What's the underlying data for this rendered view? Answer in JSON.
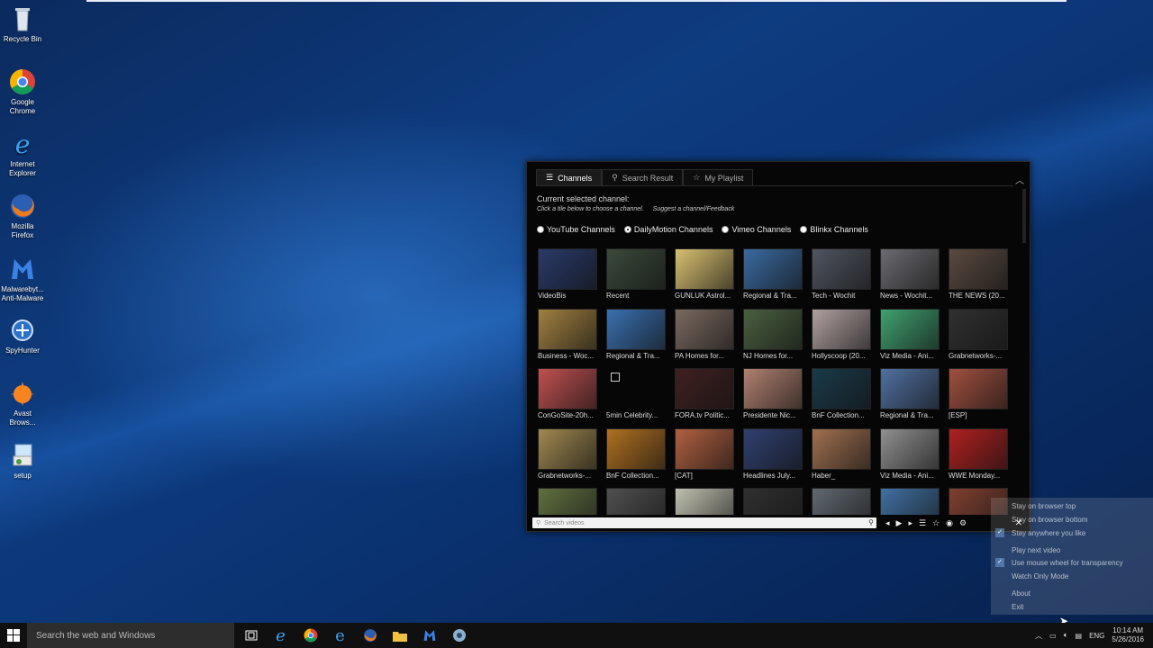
{
  "desktop": {
    "icons": [
      {
        "label": "Recycle Bin"
      },
      {
        "label": "Google Chrome"
      },
      {
        "label": "Internet Explorer"
      },
      {
        "label": "Mozilla Firefox"
      },
      {
        "label": "Malwarebyt... Anti-Malware"
      },
      {
        "label": "SpyHunter"
      },
      {
        "label": "Avast Brows..."
      },
      {
        "label": "setup"
      }
    ]
  },
  "app": {
    "tabs": [
      {
        "label": "Channels",
        "icon": "list-icon"
      },
      {
        "label": "Search Result",
        "icon": "search-icon"
      },
      {
        "label": "My Playlist",
        "icon": "star-icon"
      }
    ],
    "collapse_icon": "chevron-up-icon",
    "current_channel_label": "Current selected channel:",
    "hint": "Click a tile below to choose a channel.",
    "suggest_link": "Suggest a channel/Feedback",
    "radios": [
      {
        "label": "YouTube Channels",
        "selected": false
      },
      {
        "label": "DailyMotion Channels",
        "selected": true
      },
      {
        "label": "Vimeo Channels",
        "selected": false
      },
      {
        "label": "Blinkx Channels",
        "selected": false
      }
    ],
    "tiles": [
      {
        "label": "VideoBis",
        "color": "#2a3a6a"
      },
      {
        "label": "Recent",
        "color": "#3a4a3a"
      },
      {
        "label": "GUNLUK Astrol...",
        "color": "#d8c070"
      },
      {
        "label": "Regional & Tra...",
        "color": "#3a6aa0"
      },
      {
        "label": "Tech - Wochit",
        "color": "#505560"
      },
      {
        "label": "News - Wochit...",
        "color": "#6a6a70"
      },
      {
        "label": "THE NEWS (20...",
        "color": "#5a4a40"
      },
      {
        "label": "Business - Woc...",
        "color": "#a08040"
      },
      {
        "label": "Regional & Tra...",
        "color": "#3a70b0"
      },
      {
        "label": "PA Homes for...",
        "color": "#7a6a60"
      },
      {
        "label": "NJ Homes for...",
        "color": "#4a6040"
      },
      {
        "label": "Hollyscoop (20...",
        "color": "#b0a0a0"
      },
      {
        "label": "Viz Media - Ani...",
        "color": "#40a070"
      },
      {
        "label": "Grabnetworks-...",
        "color": "#303030"
      },
      {
        "label": "ConGoSite-20h...",
        "color": "#c05050"
      },
      {
        "label": "5min Celebrity...",
        "color": "#000000"
      },
      {
        "label": "FORA.tv Politic...",
        "color": "#402020"
      },
      {
        "label": "Presidente Nic...",
        "color": "#b08070"
      },
      {
        "label": "BnF Collection...",
        "color": "#1a3a4a"
      },
      {
        "label": "Regional & Tra...",
        "color": "#5070a0"
      },
      {
        "label": "[ESP]",
        "color": "#a05040"
      },
      {
        "label": "Grabnetworks-...",
        "color": "#a08850"
      },
      {
        "label": "BnF Collection...",
        "color": "#b07020"
      },
      {
        "label": "[CAT]",
        "color": "#b06040"
      },
      {
        "label": "Headlines July...",
        "color": "#304070"
      },
      {
        "label": "Haber_",
        "color": "#a07050"
      },
      {
        "label": "Viz Media - Ani...",
        "color": "#909090"
      },
      {
        "label": "WWE Monday...",
        "color": "#b02020"
      },
      {
        "label": "",
        "color": "#607040"
      },
      {
        "label": "",
        "color": "#505050"
      },
      {
        "label": "",
        "color": "#c0c0b0"
      },
      {
        "label": "",
        "color": "#303030"
      },
      {
        "label": "",
        "color": "#606870"
      },
      {
        "label": "",
        "color": "#4070a0"
      },
      {
        "label": "",
        "color": "#804030"
      }
    ],
    "search_placeholder": "Search videos",
    "close_icon": "close-icon"
  },
  "context_menu": {
    "items": [
      {
        "label": "Stay on browser top",
        "checked": false
      },
      {
        "label": "Stay on browser bottom",
        "checked": false
      },
      {
        "label": "Stay anywhere you like",
        "checked": true
      },
      {
        "label": "Play next video",
        "checked": false
      },
      {
        "label": "Use mouse wheel for transparency",
        "checked": true
      },
      {
        "label": "Watch Only Mode",
        "checked": false
      },
      {
        "label": "About",
        "checked": false
      },
      {
        "label": "Exit",
        "checked": false
      }
    ]
  },
  "taskbar": {
    "search_placeholder": "Search the web and Windows",
    "language": "ENG",
    "time": "10:14 AM",
    "date": "5/26/2016"
  }
}
